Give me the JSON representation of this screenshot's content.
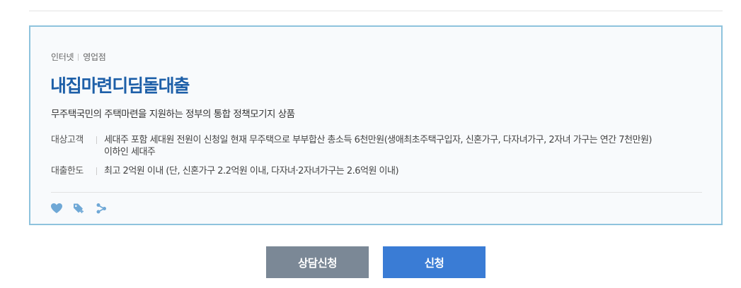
{
  "product": {
    "channels": [
      "인터넷",
      "영업점"
    ],
    "title": "내집마련디딤돌대출",
    "description": "무주택국민의 주택마련을 지원하는 정부의 통합 정책모기지 상품",
    "target_label": "대상고객",
    "target_value_line1": "세대주 포함 세대원 전원이 신청일 현재 무주택으로 부부합산 총소득 6천만원(생애최초주택구입자, 신혼가구, 다자녀가구, 2자녀 가구는 연간 7천만원)",
    "target_value_line2": "이하인 세대주",
    "limit_label": "대출한도",
    "limit_value": "최고 2억원 이내 (단, 신혼가구 2.2억원 이내, 다자녀·2자녀가구는 2.6억원 이내)"
  },
  "actions": {
    "icons": [
      "heart-icon",
      "tag-add-icon",
      "share-icon"
    ]
  },
  "buttons": {
    "consult_label": "상담신청",
    "apply_label": "신청"
  },
  "colors": {
    "title": "#1d5fa8",
    "card_border": "#8ec3dd",
    "icon": "#6fa8d6",
    "consult_button": "#7b8896",
    "apply_button": "#3a7cd5"
  }
}
